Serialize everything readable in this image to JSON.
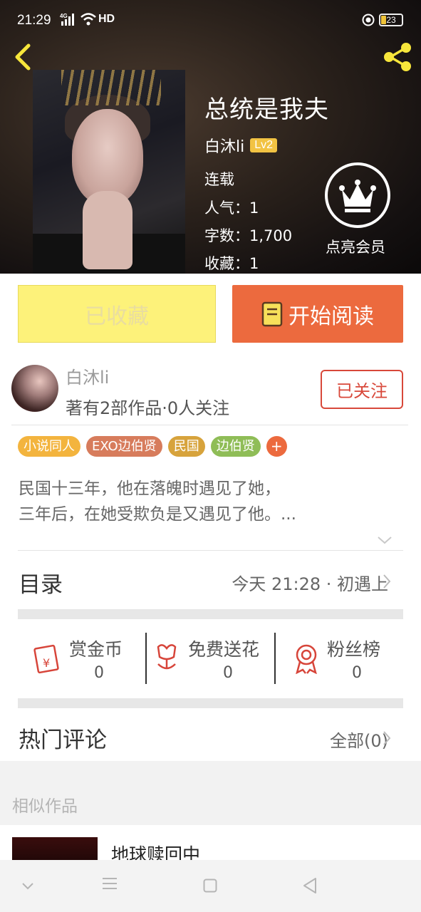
{
  "status_bar": {
    "time": "21:29",
    "network": "4G",
    "hd": "HD",
    "battery": "23"
  },
  "book": {
    "title": "总统是我夫",
    "author": "白沐li",
    "author_level": "Lv2",
    "status": "连载",
    "popularity": "人气：1",
    "word_count": "字数：1,700",
    "favorites": "收藏：1"
  },
  "vip": {
    "label": "点亮会员"
  },
  "actions": {
    "favorited_label": "已收藏",
    "read_label": "开始阅读"
  },
  "author_profile": {
    "name": "白沐li",
    "stats": "著有2部作品·0人关注",
    "follow_label": "已关注"
  },
  "tags": [
    {
      "label": "小说同人",
      "color": "#f3b43e"
    },
    {
      "label": "EXO边伯贤",
      "color": "#d77c5c"
    },
    {
      "label": "民国",
      "color": "#d7a33c"
    },
    {
      "label": "边伯贤",
      "color": "#8fbd57"
    }
  ],
  "tag_add_label": "+",
  "summary": {
    "line1": "民国十三年，他在落魄时遇见了她，",
    "line2": "三年后，在她受欺负是又遇见了他。..."
  },
  "toc": {
    "label": "目录",
    "latest": "今天 21:28 · 初遇上"
  },
  "stats": [
    {
      "label": "赏金币",
      "value": "0"
    },
    {
      "label": "免费送花",
      "value": "0"
    },
    {
      "label": "粉丝榜",
      "value": "0"
    }
  ],
  "comments": {
    "label": "热门评论",
    "all": "全部(0)"
  },
  "similar": {
    "label": "相似作品",
    "first_title": "地球赎回中"
  },
  "colors": {
    "accent": "#ec6a3e",
    "fav_bg": "#fdf27a",
    "follow": "#d8483a",
    "badge": "#f2c343"
  }
}
